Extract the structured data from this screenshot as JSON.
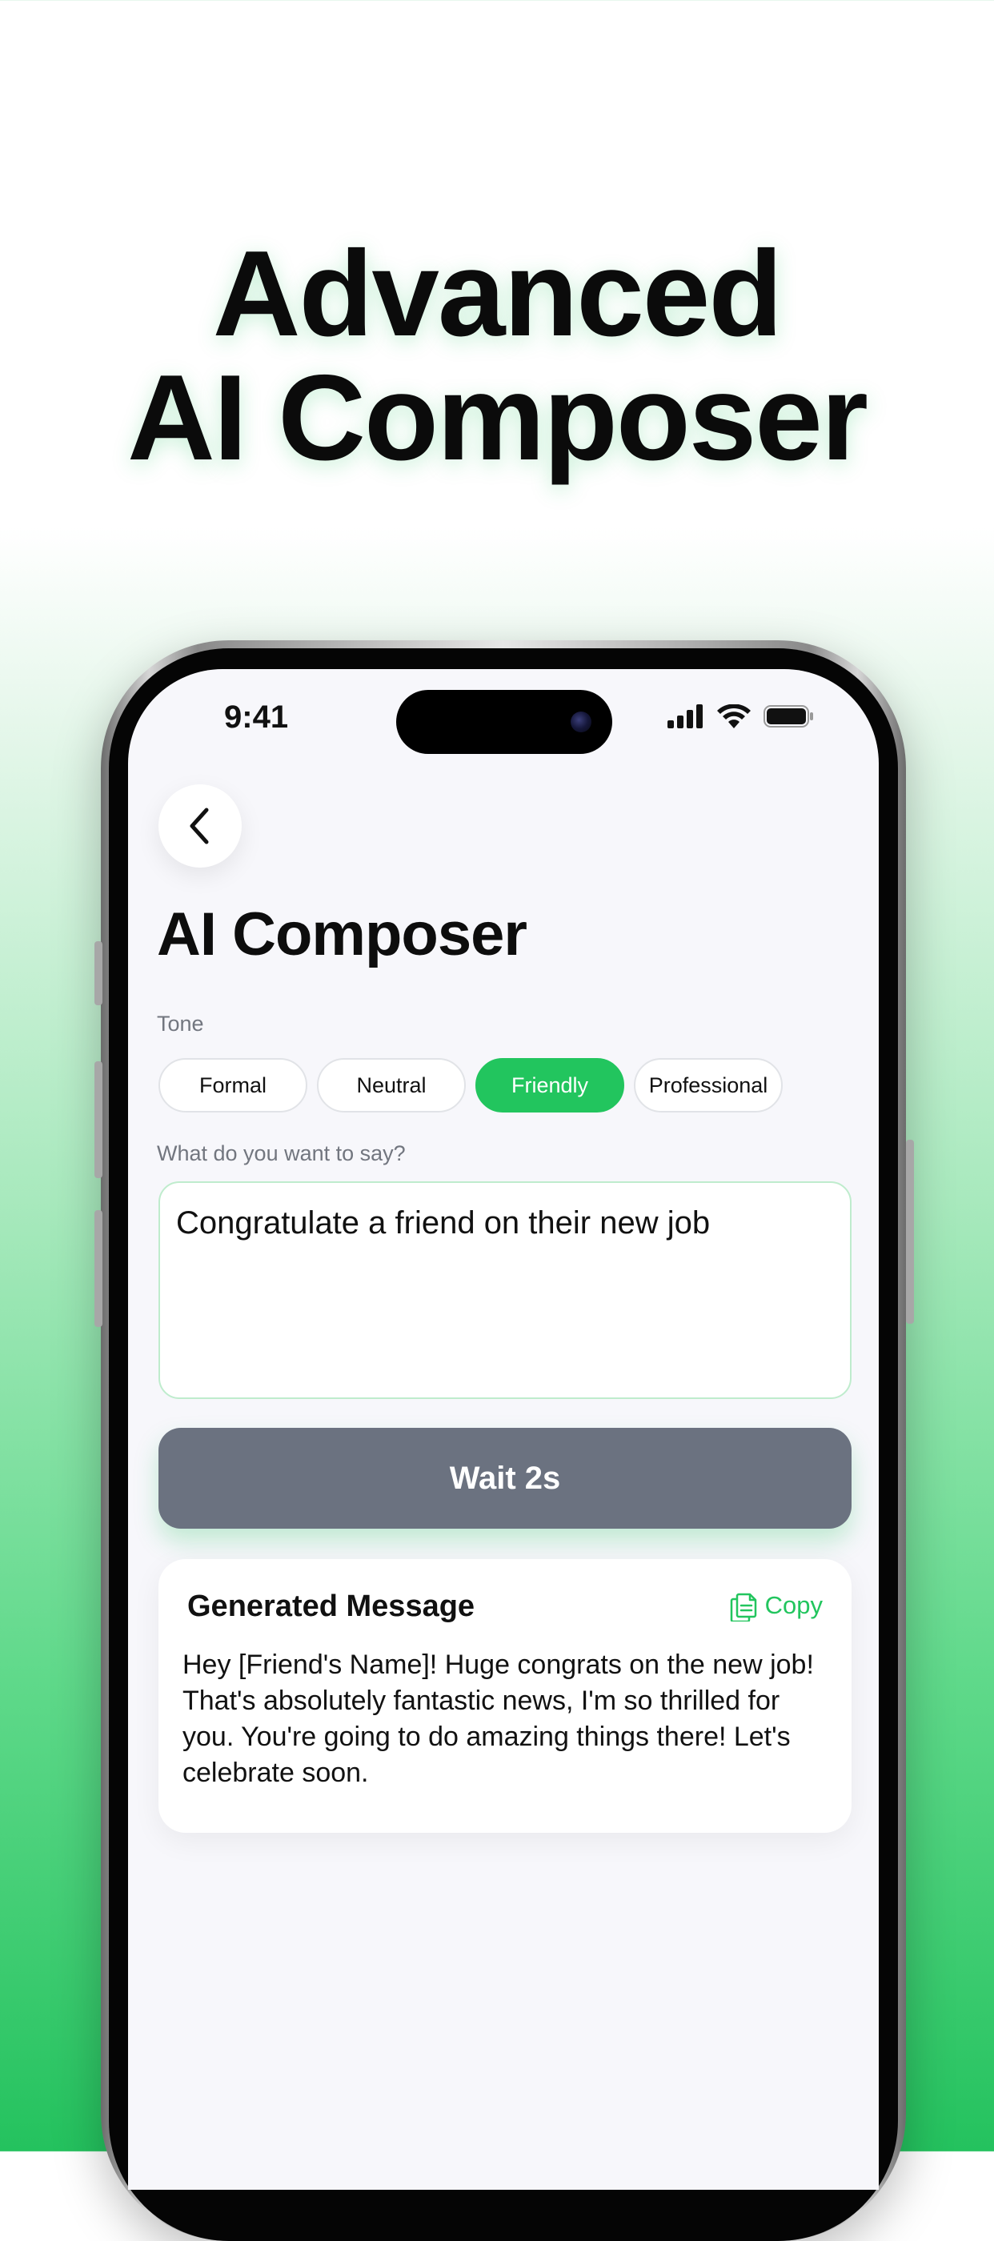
{
  "headline": {
    "line1": "Advanced",
    "line2": "AI Composer"
  },
  "status_bar": {
    "time": "9:41",
    "icons": [
      "signal-icon",
      "wifi-icon",
      "battery-icon"
    ]
  },
  "screen": {
    "back_icon": "chevron-left-icon",
    "title": "AI Composer",
    "tone": {
      "label": "Tone",
      "options": [
        "Formal",
        "Neutral",
        "Friendly",
        "Professional"
      ],
      "selected": "Friendly"
    },
    "prompt": {
      "label": "What do you want to say?",
      "value": "Congratulate a friend on their new job"
    },
    "action_button": "Wait 2s",
    "result": {
      "title": "Generated Message",
      "copy_label": "Copy",
      "copy_icon": "copy-icon",
      "message": "Hey [Friend's Name]! Huge congrats on the new job! That's absolutely fantastic news, I'm so thrilled for you. You're going to do amazing things there! Let's celebrate soon."
    }
  },
  "colors": {
    "accent": "#22c55e",
    "button_disabled": "#6b7280",
    "text": "#111111",
    "muted": "#72767f",
    "screen_bg": "#f7f7fb"
  }
}
